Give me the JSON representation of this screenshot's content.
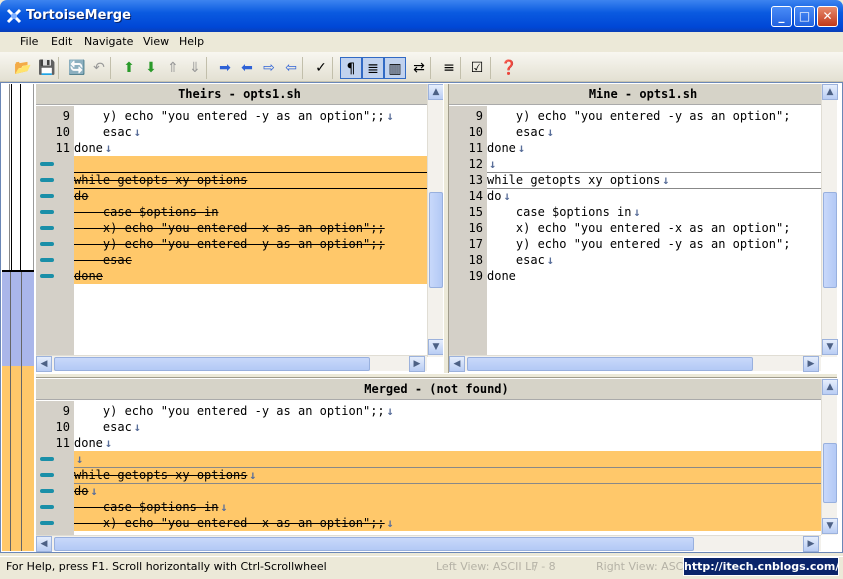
{
  "window": {
    "title": "TortoiseMerge",
    "minimize_label": "_",
    "maximize_label": "□",
    "close_label": "✕"
  },
  "menu": [
    "File",
    "Edit",
    "Navigate",
    "View",
    "Help"
  ],
  "toolbar": {
    "buttons": [
      {
        "name": "open-icon",
        "glyph": "📂"
      },
      {
        "name": "save-icon",
        "glyph": "💾"
      },
      {
        "name": "reload-icon",
        "glyph": "🔄"
      },
      {
        "name": "undo-icon",
        "glyph": "↶"
      },
      {
        "name": "prev-conflict-icon",
        "glyph": "⬆"
      },
      {
        "name": "next-conflict-icon",
        "glyph": "⬇"
      },
      {
        "name": "first-diff-icon",
        "glyph": "⇑"
      },
      {
        "name": "last-diff-icon",
        "glyph": "⇓"
      },
      {
        "name": "use-right-icon",
        "glyph": "➡"
      },
      {
        "name": "use-left-icon",
        "glyph": "⬅"
      },
      {
        "name": "use-right-block-icon",
        "glyph": "⇨"
      },
      {
        "name": "use-left-block-icon",
        "glyph": "⇦"
      },
      {
        "name": "mark-icon",
        "glyph": "✓"
      },
      {
        "name": "whitespace-icon",
        "glyph": "¶"
      },
      {
        "name": "inline-diff-icon",
        "glyph": "≣"
      },
      {
        "name": "one-pane-icon",
        "glyph": "▥"
      },
      {
        "name": "switch-icon",
        "glyph": "⇄"
      },
      {
        "name": "line-diff-icon",
        "glyph": "≡"
      },
      {
        "name": "settings-icon",
        "glyph": "☑"
      },
      {
        "name": "help-icon",
        "glyph": "❓"
      }
    ]
  },
  "theirs": {
    "header": "Theirs - opts1.sh",
    "lines": [
      {
        "num": "9",
        "text": "    y) echo \"you entered -y as an option\";;",
        "arrow": "→",
        "eol": "↓",
        "hl": false,
        "strike": false
      },
      {
        "num": "10",
        "text": "    esac",
        "arrow": "→",
        "eol": "↓",
        "hl": false,
        "strike": false
      },
      {
        "num": "11",
        "text": "done",
        "arrow": "",
        "eol": "↓",
        "hl": false,
        "strike": false
      },
      {
        "num": "",
        "text": "",
        "arrow": "",
        "eol": "",
        "hl": true,
        "strike": false
      },
      {
        "num": "",
        "text": "while getopts xy options",
        "arrow": "",
        "eol": "",
        "hl": true,
        "strike": true
      },
      {
        "num": "",
        "text": "do",
        "arrow": "",
        "eol": "",
        "hl": true,
        "strike": true
      },
      {
        "num": "",
        "text": "    case $options in",
        "arrow": "",
        "eol": "",
        "hl": true,
        "strike": true
      },
      {
        "num": "",
        "text": "    x) echo \"you entered -x as an option\";;",
        "arrow": "",
        "eol": "",
        "hl": true,
        "strike": true
      },
      {
        "num": "",
        "text": "    y) echo \"you entered -y as an option\";;",
        "arrow": "",
        "eol": "",
        "hl": true,
        "strike": true
      },
      {
        "num": "",
        "text": "    esac",
        "arrow": "",
        "eol": "",
        "hl": true,
        "strike": true
      },
      {
        "num": "",
        "text": "done",
        "arrow": "",
        "eol": "",
        "hl": true,
        "strike": true
      }
    ]
  },
  "mine": {
    "header": "Mine - opts1.sh",
    "lines": [
      {
        "num": "9",
        "text": "    y) echo \"you entered -y as an option\";",
        "eol": ""
      },
      {
        "num": "10",
        "text": "    esac",
        "eol": "↓"
      },
      {
        "num": "11",
        "text": "done",
        "eol": "↓"
      },
      {
        "num": "12",
        "text": "",
        "eol": "↓"
      },
      {
        "num": "13",
        "text": "while getopts xy options",
        "eol": "↓"
      },
      {
        "num": "14",
        "text": "do",
        "eol": "↓"
      },
      {
        "num": "15",
        "text": "    case $options in",
        "eol": "↓"
      },
      {
        "num": "16",
        "text": "    x) echo \"you entered -x as an option\";",
        "eol": ""
      },
      {
        "num": "17",
        "text": "    y) echo \"you entered -y as an option\";",
        "eol": ""
      },
      {
        "num": "18",
        "text": "    esac",
        "eol": "↓"
      },
      {
        "num": "19",
        "text": "done",
        "eol": ""
      }
    ]
  },
  "merged": {
    "header": "Merged -  (not found)",
    "lines": [
      {
        "num": "9",
        "text": "    y) echo \"you entered -y as an option\";;",
        "eol": "↓",
        "hl": false,
        "strike": false
      },
      {
        "num": "10",
        "text": "    esac",
        "eol": "↓",
        "hl": false,
        "strike": false
      },
      {
        "num": "11",
        "text": "done",
        "eol": "↓",
        "hl": false,
        "strike": false
      },
      {
        "num": "",
        "text": "",
        "eol": "↓",
        "hl": true,
        "strike": false
      },
      {
        "num": "",
        "text": "while getopts xy options",
        "eol": "↓",
        "hl": true,
        "strike": true
      },
      {
        "num": "",
        "text": "do",
        "eol": "↓",
        "hl": true,
        "strike": true
      },
      {
        "num": "",
        "text": "    case $options in",
        "eol": "↓",
        "hl": true,
        "strike": true
      },
      {
        "num": "",
        "text": "    x) echo \"you entered -x as an option\";;",
        "eol": "↓",
        "hl": true,
        "strike": true
      }
    ]
  },
  "status": {
    "help": "For Help, press F1. Scroll horizontally with Ctrl-Scrollwheel",
    "left_view": "Left View: ASCII LF",
    "left_count": "/ - 8",
    "right_view": "Right View: ASCII",
    "url": "http://itech.cnblogs.com/"
  },
  "colors": {
    "conflict": "#ffc86a",
    "marker": "#1a8fa8",
    "title_blue": "#0a5ae0"
  }
}
